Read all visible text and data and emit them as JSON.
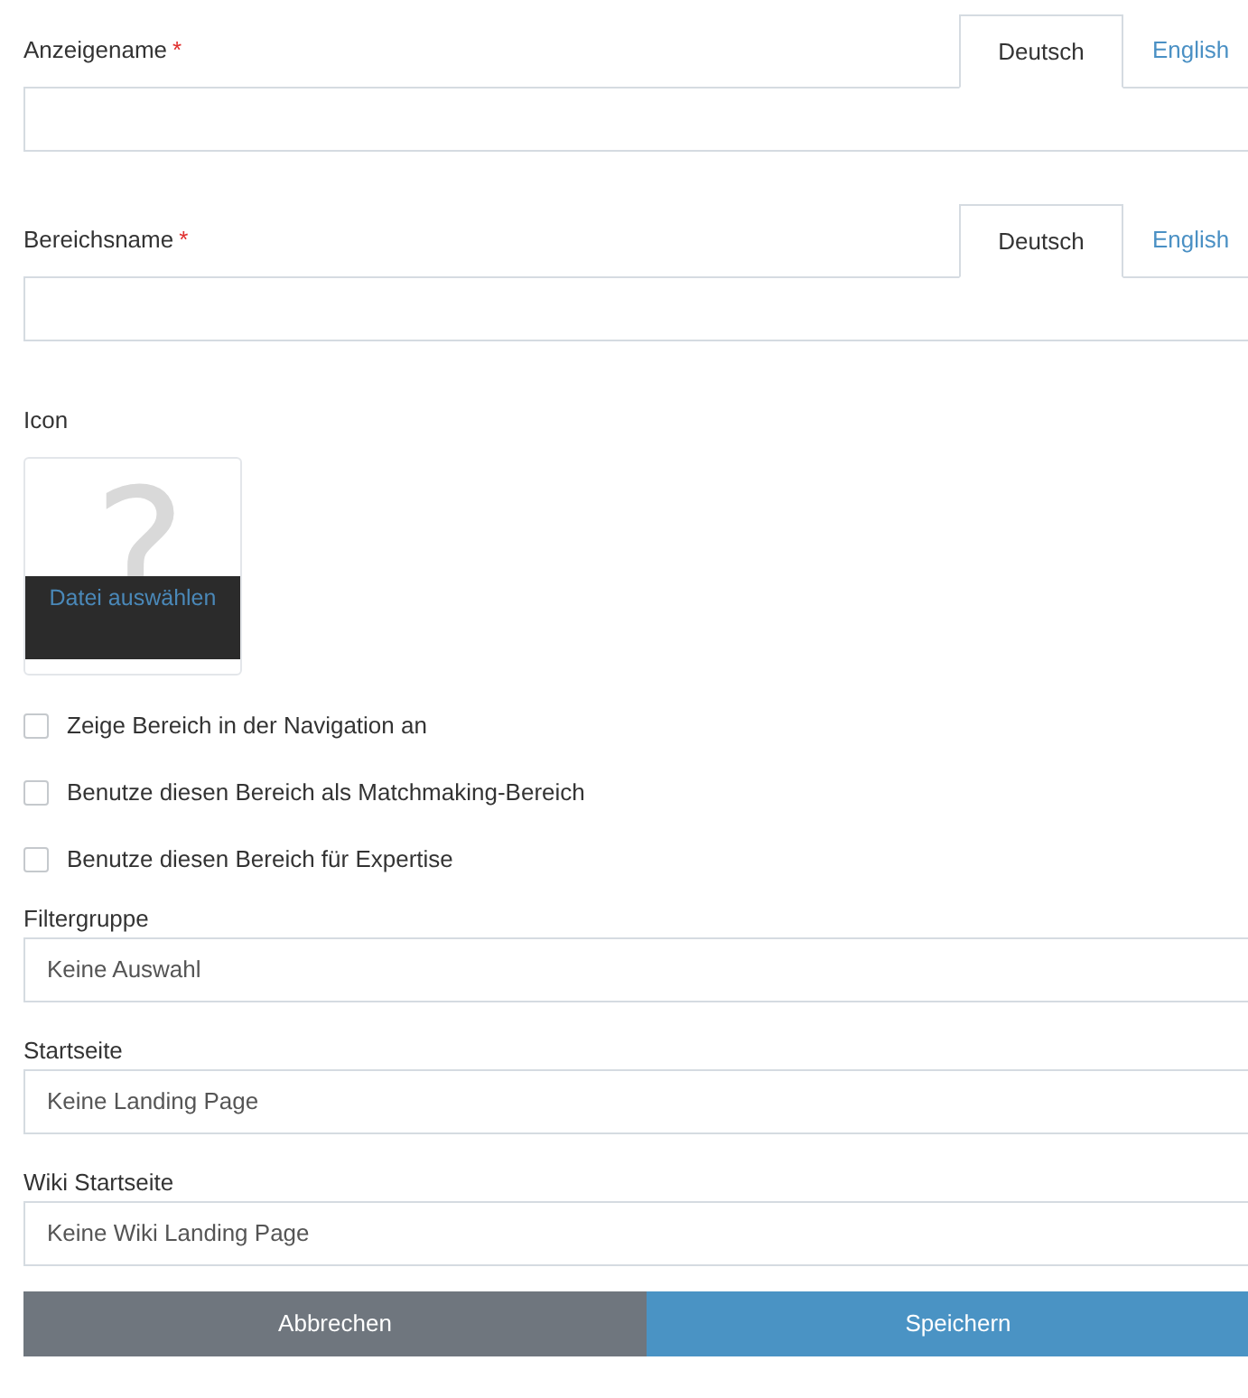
{
  "name_fields": [
    {
      "label": "Anzeigename",
      "required_mark": "*",
      "tabs": [
        {
          "label": "Deutsch",
          "selected": true
        },
        {
          "label": "English",
          "selected": false
        }
      ]
    },
    {
      "label": "Bereichsname",
      "required_mark": "*",
      "tabs": [
        {
          "label": "Deutsch",
          "selected": true
        },
        {
          "label": "English",
          "selected": false
        }
      ]
    }
  ],
  "icon": {
    "label": "Icon",
    "placeholder_glyph": "?",
    "upload_label": "Datei auswählen"
  },
  "checkboxes": [
    {
      "label": "Zeige Bereich in der Navigation an",
      "checked": false
    },
    {
      "label": "Benutze diesen Bereich als Matchmaking-Bereich",
      "checked": false
    },
    {
      "label": "Benutze diesen Bereich für Expertise",
      "checked": false
    }
  ],
  "selects": [
    {
      "label": "Filtergruppe",
      "value": "Keine Auswahl"
    },
    {
      "label": "Startseite",
      "value": "Keine Landing Page"
    },
    {
      "label": "Wiki Startseite",
      "value": "Keine Wiki Landing Page"
    }
  ],
  "buttons": [
    {
      "label": "Abbrechen",
      "kind": "cancel"
    },
    {
      "label": "Speichern",
      "kind": "primary"
    }
  ]
}
